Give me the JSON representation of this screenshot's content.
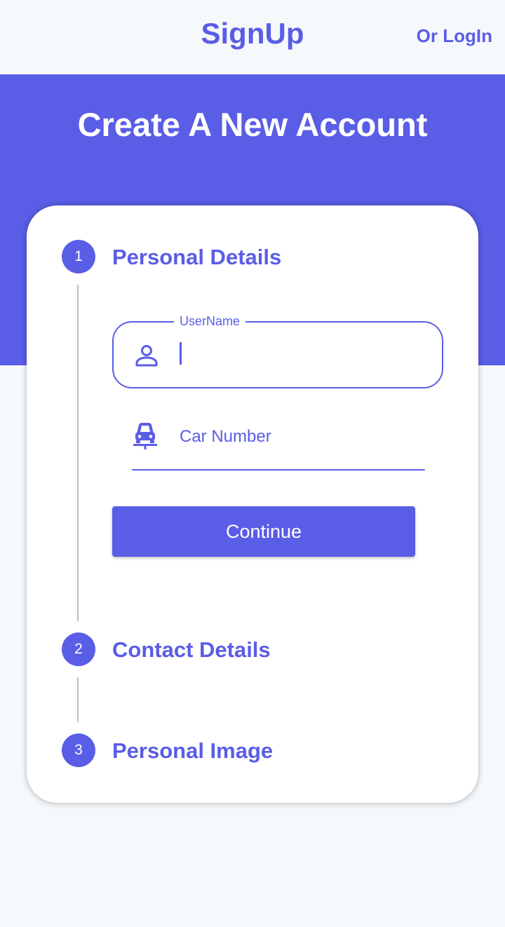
{
  "appbar": {
    "title": "SignUp",
    "login_link": "Or LogIn"
  },
  "banner": {
    "title": "Create A New Account"
  },
  "steps": [
    {
      "number": "1",
      "title": "Personal Details",
      "fields": {
        "username": {
          "label": "UserName",
          "value": "",
          "icon": "person-icon"
        },
        "car_number": {
          "placeholder": "Car Number",
          "icon": "car-icon"
        }
      },
      "continue_label": "Continue"
    },
    {
      "number": "2",
      "title": "Contact Details"
    },
    {
      "number": "3",
      "title": "Personal Image"
    }
  ],
  "colors": {
    "primary": "#5a5de6",
    "background": "#f6f9fb",
    "card": "#ffffff",
    "connector": "#bdbdbd"
  }
}
